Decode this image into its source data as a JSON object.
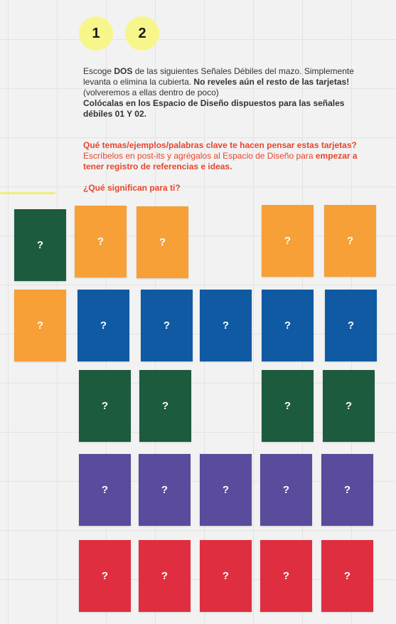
{
  "steps": [
    "1",
    "2"
  ],
  "instructions": {
    "p1_a": "Escoge ",
    "p1_b": "DOS",
    "p1_c": " de las siguientes Señales Débiles del mazo. Simplemente levanta o elimina la cubierta. ",
    "p1_d": "No reveles aún el resto de las tarjetas!",
    "p1_e": " (volveremos a ellas dentro de poco)",
    "p2": "Colócalas en los Espacio de Diseño dispuestos para las señales débiles 01 Y 02.",
    "q1_a": "Qué temas/ejemplos/palabras clave te hacen pensar estas tarjetas?",
    "q1_b": "Escríbelos en post-its y agrégalos al Espacio de Diseño para ",
    "q1_c": "empezar a tener registro de referencias e ideas.",
    "q2": "¿Qué significan para ti?"
  },
  "card_label": "?",
  "colors": {
    "green": "#1c5b3d",
    "orange": "#f6a037",
    "blue": "#0f5aa3",
    "purple": "#5a4b9c",
    "red": "#e02e41"
  },
  "cards": [
    {
      "color": "green"
    },
    {
      "color": "orange"
    },
    {
      "color": "orange"
    },
    {
      "color": "orange"
    },
    {
      "color": "orange"
    },
    {
      "color": "orange"
    },
    {
      "color": "blue"
    },
    {
      "color": "blue"
    },
    {
      "color": "blue"
    },
    {
      "color": "blue"
    },
    {
      "color": "blue"
    },
    {
      "color": "green"
    },
    {
      "color": "green"
    },
    {
      "color": "green"
    },
    {
      "color": "green"
    },
    {
      "color": "purple"
    },
    {
      "color": "purple"
    },
    {
      "color": "purple"
    },
    {
      "color": "purple"
    },
    {
      "color": "purple"
    },
    {
      "color": "red"
    },
    {
      "color": "red"
    },
    {
      "color": "red"
    },
    {
      "color": "red"
    },
    {
      "color": "red"
    }
  ]
}
